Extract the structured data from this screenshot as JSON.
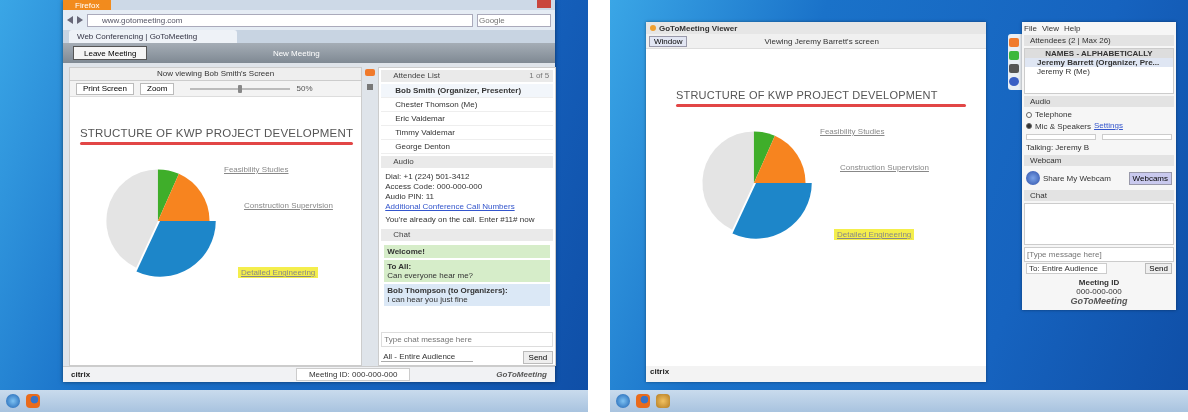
{
  "left_screen": {
    "browser": {
      "menu_button": "Firefox",
      "url": "www.gotomeeting.com",
      "search_placeholder": "Google",
      "tab": "Web Conferencing | GoToMeeting"
    },
    "app_header": {
      "leave_button": "Leave Meeting",
      "title": "New Meeting"
    },
    "viewer": {
      "header": "Now viewing Bob Smith's Screen",
      "toolbar_buttons": [
        "Print Screen",
        "Zoom"
      ],
      "zoom_reading": "50%",
      "zoom_slider": {
        "level": 0.5
      }
    },
    "slide": {
      "title": "STRUCTURE OF KWP PROJECT DEVELOPMENT",
      "labels": [
        {
          "text": "Feasibility Studies",
          "highlighted": false
        },
        {
          "text": "Construction Supervision",
          "highlighted": false
        },
        {
          "text": "Detailed Engineering",
          "highlighted": true
        }
      ]
    },
    "attendees": {
      "title": "Attendee List",
      "count": "1 of 5",
      "items": [
        {
          "name": "Bob Smith (Organizer, Presenter)",
          "selected": true
        },
        {
          "name": "Chester Thomson (Me)",
          "selected": false
        },
        {
          "name": "Eric Valdemar",
          "selected": false
        },
        {
          "name": "Timmy Valdemar",
          "selected": false
        },
        {
          "name": "George Denton",
          "selected": false
        }
      ]
    },
    "audio": {
      "title": "Audio",
      "lines": [
        "Dial: +1 (224) 501-3412",
        "Access Code: 000-000-000",
        "Audio PIN: 11"
      ],
      "link": "Additional Conference Call Numbers",
      "note": "You're already on the call. Enter #11# now"
    },
    "chat": {
      "title": "Chat",
      "messages": [
        {
          "from": "Welcome!",
          "kind": "system"
        },
        {
          "from": "To All:",
          "text": "Can everyone hear me?",
          "kind": "sent"
        },
        {
          "from": "Bob Thompson (to Organizers):",
          "text": "I can hear you just fine",
          "kind": "received"
        }
      ],
      "placeholder": "Type chat message here",
      "recipient": "All - Entire Audience",
      "send": "Send"
    },
    "footer": {
      "brand": "citrix",
      "meeting_id": "Meeting ID: 000-000-000",
      "product": "GoToMeeting"
    }
  },
  "right_screen": {
    "viewer": {
      "title": "GoToMeeting Viewer",
      "window_button": "Window",
      "header": "Viewing Jeremy Barrett's screen"
    },
    "slide": {
      "title": "STRUCTURE OF KWP PROJECT DEVELOPMENT",
      "labels": [
        {
          "text": "Feasibility Studies",
          "highlighted": false
        },
        {
          "text": "Construction Supervision",
          "highlighted": false
        },
        {
          "text": "Detailed Engineering",
          "highlighted": true
        }
      ]
    },
    "brand": "citrix",
    "panel": {
      "menu": [
        "File",
        "View",
        "Help"
      ],
      "attendee_title": "Attendees (2 | Max 26)",
      "sort_header": "NAMES - ALPHABETICALLY",
      "attendees": [
        {
          "name": "Jeremy Barrett (Organizer, Pre...",
          "selected": true
        },
        {
          "name": "Jeremy R (Me)",
          "selected": false
        }
      ],
      "audio_title": "Audio",
      "audio_options": [
        {
          "label": "Telephone",
          "selected": false
        },
        {
          "label": "Mic & Speakers",
          "selected": true
        }
      ],
      "settings_link": "Settings",
      "talking": "Talking: Jeremy B",
      "webcam_title": "Webcam",
      "webcam_label": "Share My Webcam",
      "webcam_button": "Webcams",
      "chat_title": "Chat",
      "chat_placeholder": "[Type message here]",
      "chat_to": "To: Entire Audience",
      "send": "Send",
      "meeting_label": "Meeting ID",
      "meeting_id": "000-000-000",
      "product": "GoToMeeting"
    }
  }
}
